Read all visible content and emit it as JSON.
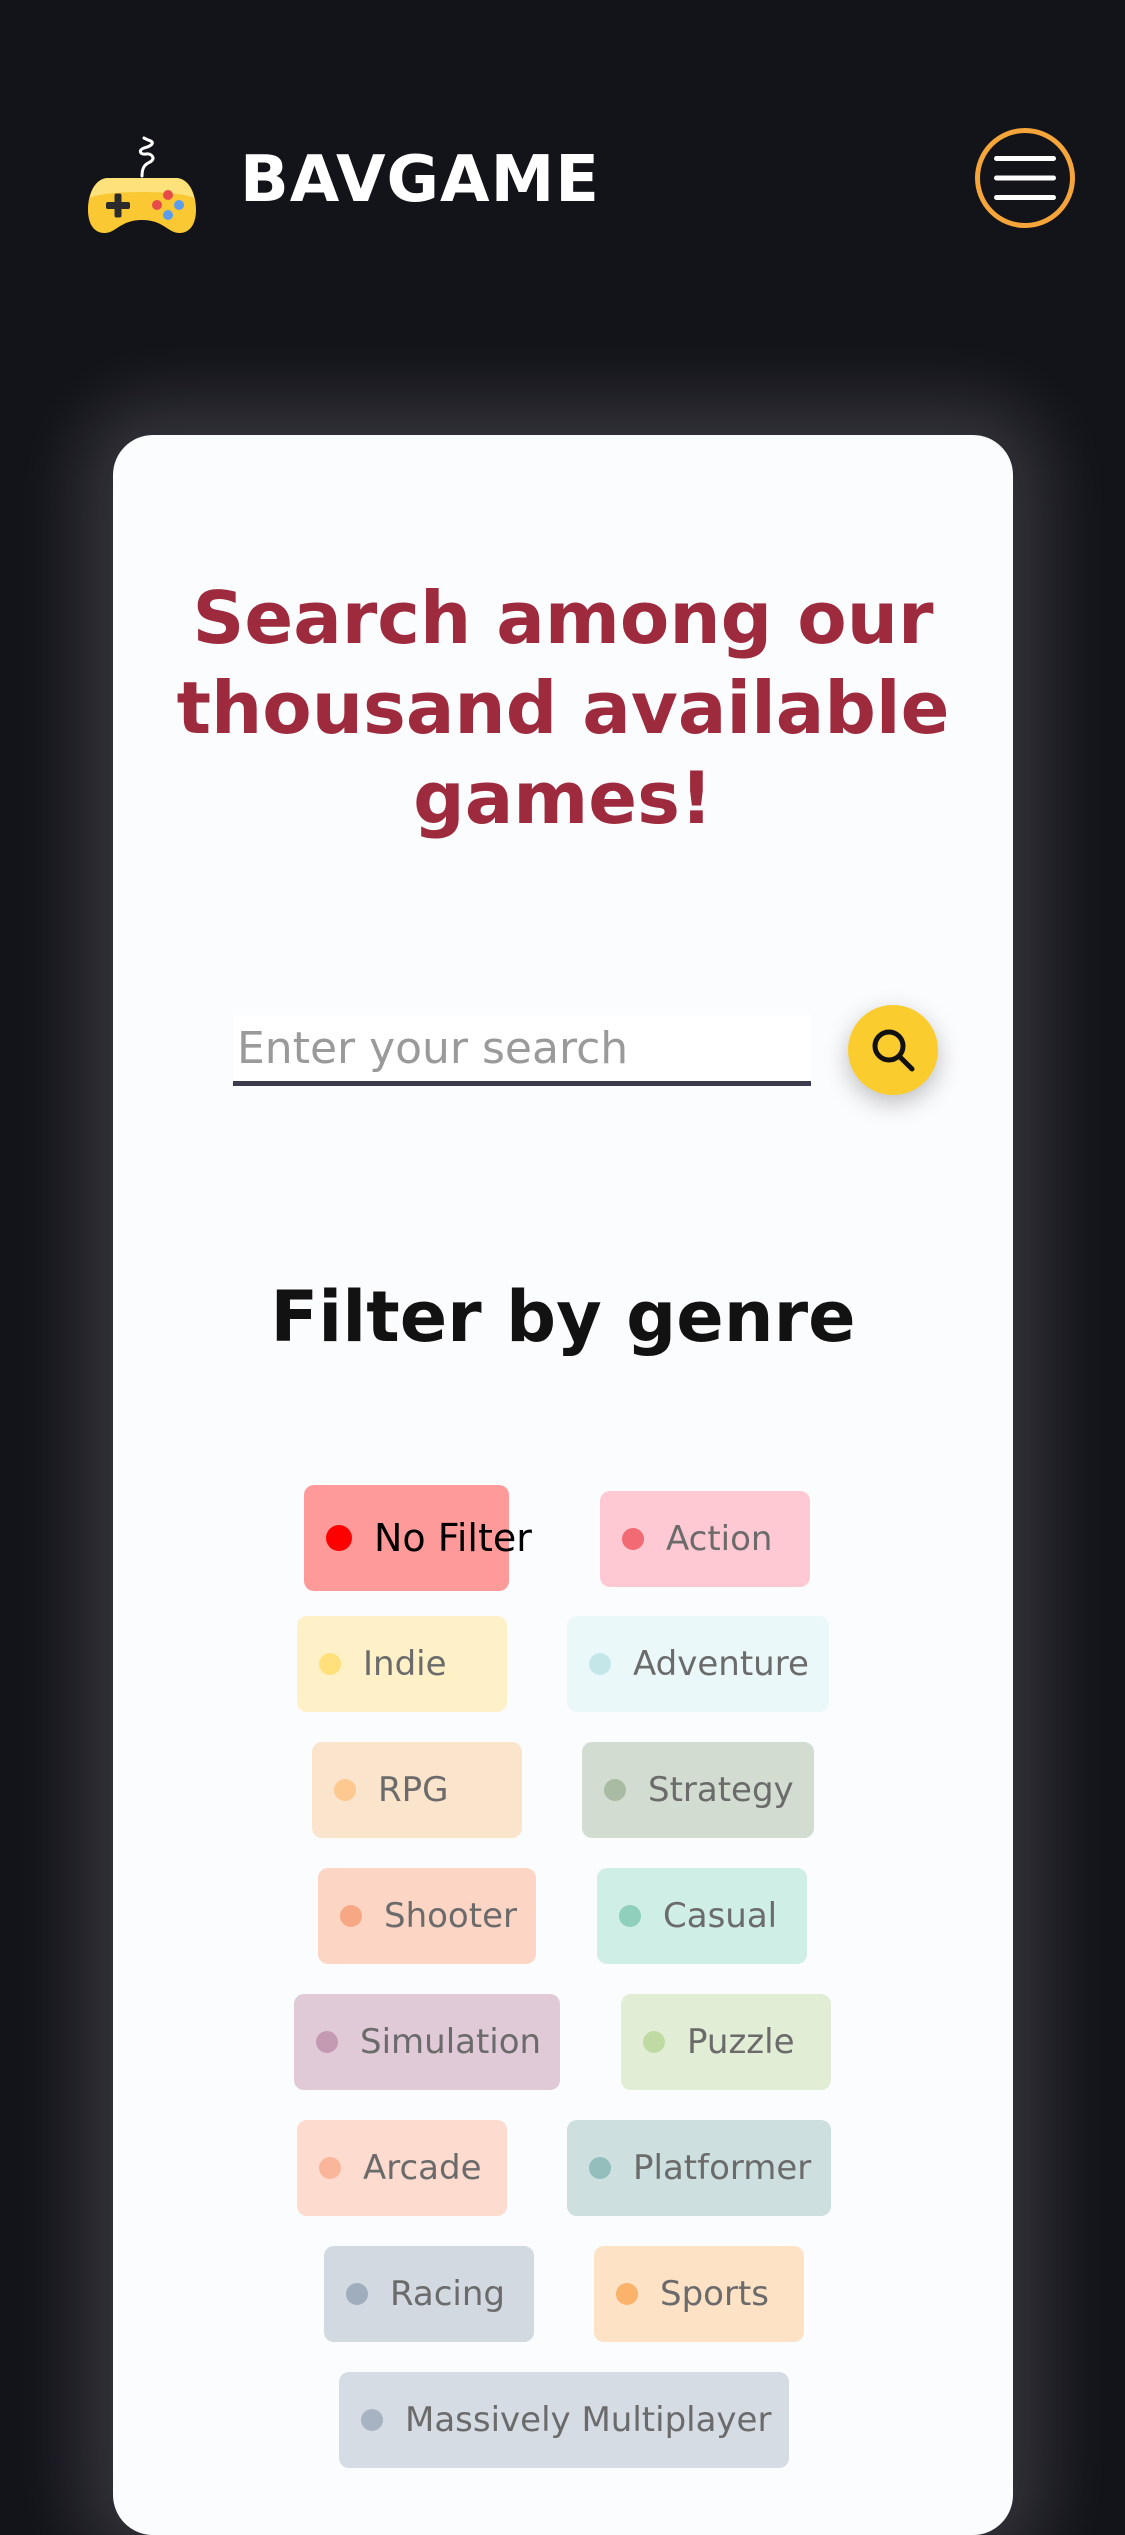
{
  "header": {
    "brand": "BAVGAME",
    "logo_icon": "gamepad-icon",
    "menu_icon": "hamburger-menu-icon",
    "accent_color": "#f5a53a"
  },
  "main": {
    "headline_lines": [
      "Search among our",
      "thousand available",
      "games!"
    ],
    "search": {
      "placeholder": "Enter your search",
      "value": "",
      "button_icon": "search-icon"
    },
    "filter_title": "Filter by genre",
    "genres": [
      {
        "label": "No Filter",
        "active": true,
        "bg": "#ff9a9a",
        "dot": "#ff0000"
      },
      {
        "label": "Action",
        "active": false,
        "bg": "#ffc9d3",
        "dot": "#f26a73"
      },
      {
        "label": "Indie",
        "active": false,
        "bg": "#fff1c7",
        "dot": "#ffe07a"
      },
      {
        "label": "Adventure",
        "active": false,
        "bg": "#eaf8f9",
        "dot": "#c5e6e8"
      },
      {
        "label": "RPG",
        "active": false,
        "bg": "#fbe4cc",
        "dot": "#fdc991"
      },
      {
        "label": "Strategy",
        "active": false,
        "bg": "#d2dcd0",
        "dot": "#a9bba3"
      },
      {
        "label": "Shooter",
        "active": false,
        "bg": "#fcd5c4",
        "dot": "#f6a885"
      },
      {
        "label": "Casual",
        "active": false,
        "bg": "#cfeee5",
        "dot": "#8fcfbc"
      },
      {
        "label": "Simulation",
        "active": false,
        "bg": "#e1cad7",
        "dot": "#c49ab3"
      },
      {
        "label": "Puzzle",
        "active": false,
        "bg": "#e2edd5",
        "dot": "#bfdba3"
      },
      {
        "label": "Arcade",
        "active": false,
        "bg": "#fddccf",
        "dot": "#fab69b"
      },
      {
        "label": "Platformer",
        "active": false,
        "bg": "#cde0df",
        "dot": "#94bebc"
      },
      {
        "label": "Racing",
        "active": false,
        "bg": "#d2d9e0",
        "dot": "#9fadbd"
      },
      {
        "label": "Sports",
        "active": false,
        "bg": "#fde2c6",
        "dot": "#fbb26a"
      },
      {
        "label": "Massively Multiplayer",
        "active": false,
        "bg": "#d6dce4",
        "dot": "#a7b3c2"
      }
    ]
  }
}
